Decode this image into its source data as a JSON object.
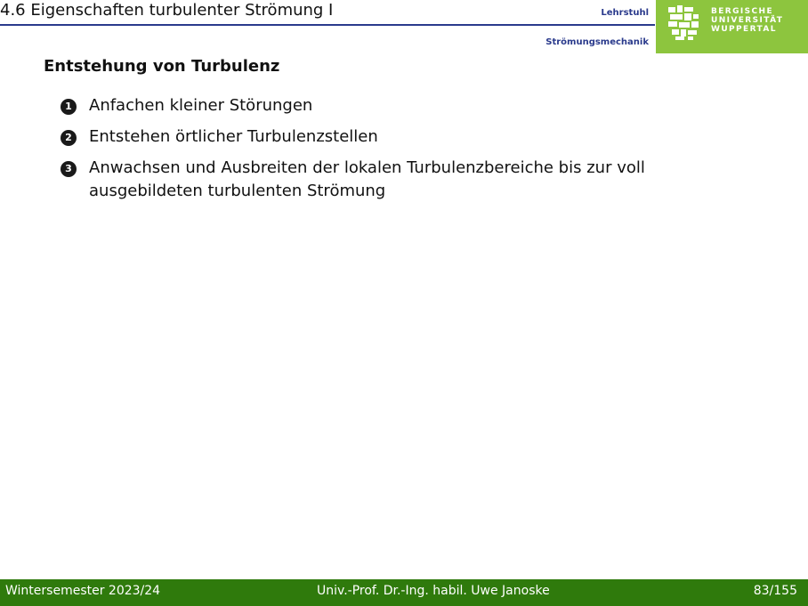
{
  "header": {
    "section_title": "4.6 Eigenschaften turbulenter Strömung I",
    "chair_line1": "Lehrstuhl",
    "chair_line2": "Strömungsmechanik",
    "university": {
      "line1": "BERGISCHE",
      "line2": "UNIVERSITÄT",
      "line3": "WUPPERTAL",
      "logo_icon": "lion-crest-icon",
      "bg_color": "#8dc53e"
    }
  },
  "content": {
    "heading": "Entstehung von Turbulenz",
    "items": [
      {
        "number": "1",
        "text": "Anfachen kleiner Störungen"
      },
      {
        "number": "2",
        "text": "Entstehen örtlicher Turbulenzstellen"
      },
      {
        "number": "3",
        "text": "Anwachsen und Ausbreiten der lokalen Turbulenzbereiche bis zur voll ausgebildeten turbulenten Strömung"
      }
    ]
  },
  "footer": {
    "semester": "Wintersemester 2023/24",
    "author": "Univ.-Prof. Dr.-Ing. habil. Uwe Janoske",
    "page": "83/155",
    "bg_color": "#2f7a0c"
  },
  "colors": {
    "accent_blue": "#2a3a8c",
    "footer_green": "#2f7a0c",
    "logo_green": "#8dc53e"
  }
}
